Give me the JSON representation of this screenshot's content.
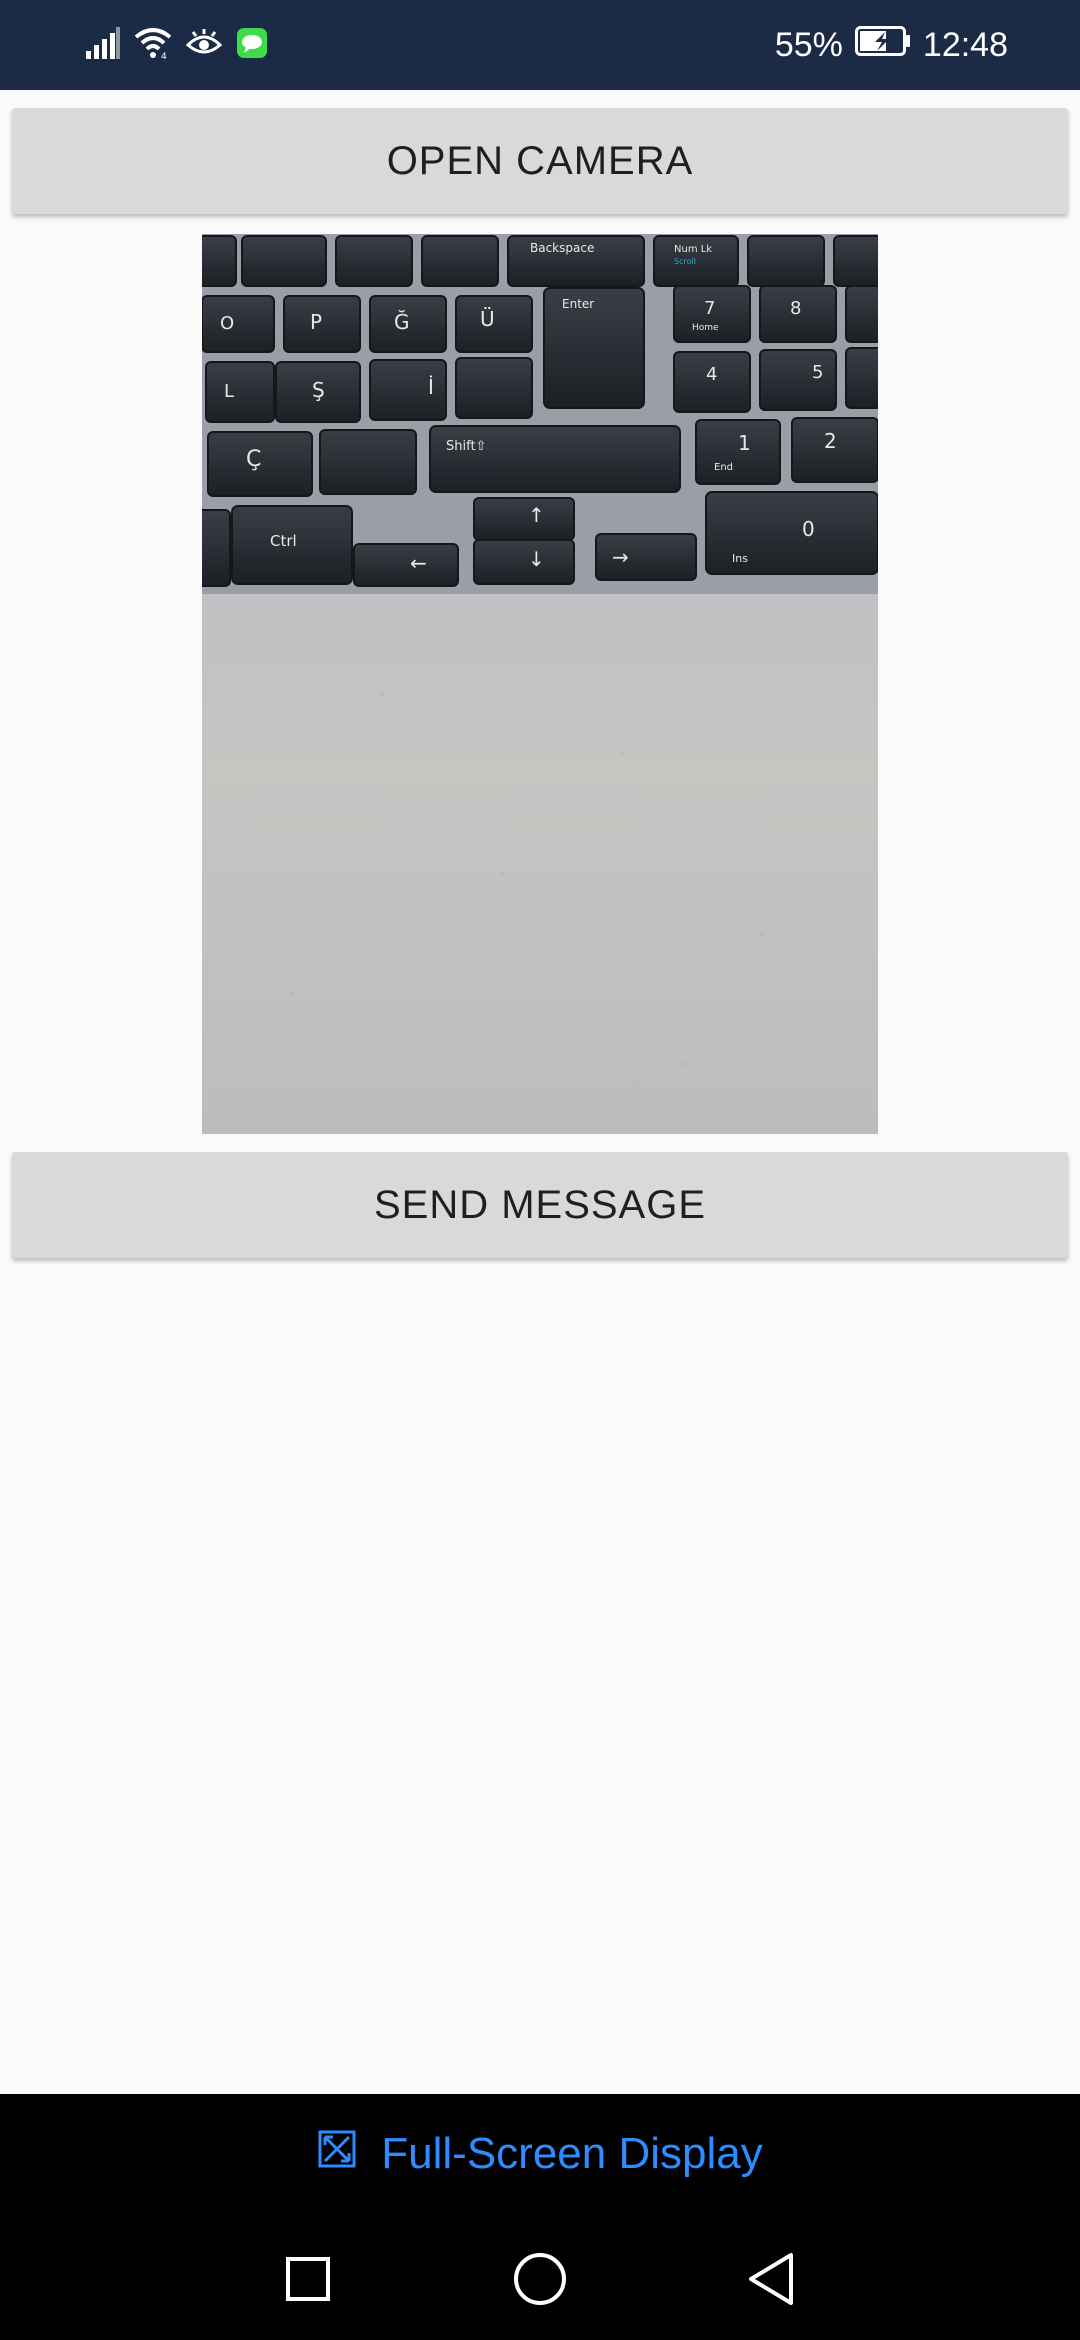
{
  "status_bar": {
    "battery_percent": "55%",
    "time": "12:48",
    "icons": [
      "signal-icon",
      "wifi-icon",
      "eye-comfort-icon",
      "message-notification-icon",
      "battery-charging-icon"
    ],
    "background": "#1b2b45"
  },
  "buttons": {
    "open_camera": "OPEN CAMERA",
    "send_message": "SEND MESSAGE"
  },
  "photo": {
    "keys": [
      "Backspace",
      "Num Lk",
      "Scroll",
      "Enter",
      "7",
      "Home",
      "8",
      "4",
      "5",
      "1",
      "End",
      "2",
      "0",
      "Ins",
      "O",
      "P",
      "Ğ",
      "Ü",
      "L",
      "Ş",
      "İ",
      "Ç",
      "Shift",
      "Ctrl"
    ]
  },
  "fullscreen_bar": {
    "label": "Full-Screen Display",
    "color": "#2d8cff"
  },
  "nav_bar": {
    "items": [
      "recents-square-icon",
      "home-circle-icon",
      "back-triangle-icon"
    ]
  }
}
